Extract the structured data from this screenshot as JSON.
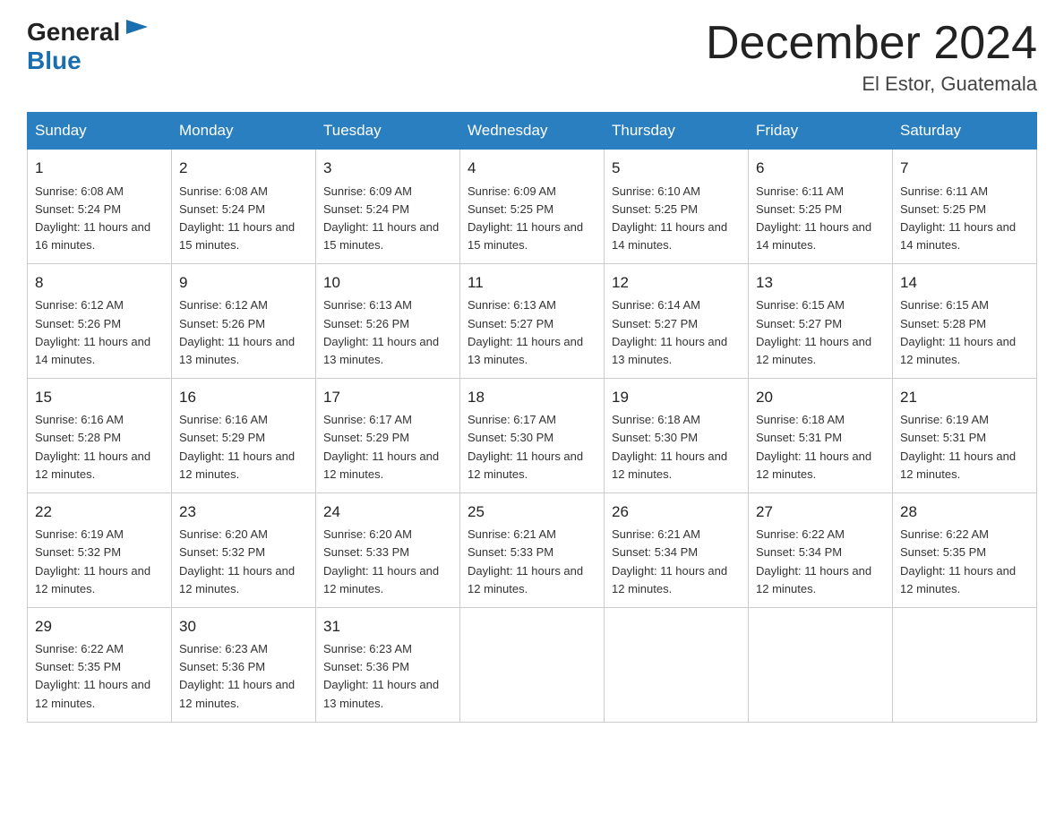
{
  "header": {
    "logo_general": "General",
    "logo_blue": "Blue",
    "month_title": "December 2024",
    "location": "El Estor, Guatemala"
  },
  "days_of_week": [
    "Sunday",
    "Monday",
    "Tuesday",
    "Wednesday",
    "Thursday",
    "Friday",
    "Saturday"
  ],
  "weeks": [
    [
      {
        "day": "1",
        "sunrise": "6:08 AM",
        "sunset": "5:24 PM",
        "daylight": "11 hours and 16 minutes."
      },
      {
        "day": "2",
        "sunrise": "6:08 AM",
        "sunset": "5:24 PM",
        "daylight": "11 hours and 15 minutes."
      },
      {
        "day": "3",
        "sunrise": "6:09 AM",
        "sunset": "5:24 PM",
        "daylight": "11 hours and 15 minutes."
      },
      {
        "day": "4",
        "sunrise": "6:09 AM",
        "sunset": "5:25 PM",
        "daylight": "11 hours and 15 minutes."
      },
      {
        "day": "5",
        "sunrise": "6:10 AM",
        "sunset": "5:25 PM",
        "daylight": "11 hours and 14 minutes."
      },
      {
        "day": "6",
        "sunrise": "6:11 AM",
        "sunset": "5:25 PM",
        "daylight": "11 hours and 14 minutes."
      },
      {
        "day": "7",
        "sunrise": "6:11 AM",
        "sunset": "5:25 PM",
        "daylight": "11 hours and 14 minutes."
      }
    ],
    [
      {
        "day": "8",
        "sunrise": "6:12 AM",
        "sunset": "5:26 PM",
        "daylight": "11 hours and 14 minutes."
      },
      {
        "day": "9",
        "sunrise": "6:12 AM",
        "sunset": "5:26 PM",
        "daylight": "11 hours and 13 minutes."
      },
      {
        "day": "10",
        "sunrise": "6:13 AM",
        "sunset": "5:26 PM",
        "daylight": "11 hours and 13 minutes."
      },
      {
        "day": "11",
        "sunrise": "6:13 AM",
        "sunset": "5:27 PM",
        "daylight": "11 hours and 13 minutes."
      },
      {
        "day": "12",
        "sunrise": "6:14 AM",
        "sunset": "5:27 PM",
        "daylight": "11 hours and 13 minutes."
      },
      {
        "day": "13",
        "sunrise": "6:15 AM",
        "sunset": "5:27 PM",
        "daylight": "11 hours and 12 minutes."
      },
      {
        "day": "14",
        "sunrise": "6:15 AM",
        "sunset": "5:28 PM",
        "daylight": "11 hours and 12 minutes."
      }
    ],
    [
      {
        "day": "15",
        "sunrise": "6:16 AM",
        "sunset": "5:28 PM",
        "daylight": "11 hours and 12 minutes."
      },
      {
        "day": "16",
        "sunrise": "6:16 AM",
        "sunset": "5:29 PM",
        "daylight": "11 hours and 12 minutes."
      },
      {
        "day": "17",
        "sunrise": "6:17 AM",
        "sunset": "5:29 PM",
        "daylight": "11 hours and 12 minutes."
      },
      {
        "day": "18",
        "sunrise": "6:17 AM",
        "sunset": "5:30 PM",
        "daylight": "11 hours and 12 minutes."
      },
      {
        "day": "19",
        "sunrise": "6:18 AM",
        "sunset": "5:30 PM",
        "daylight": "11 hours and 12 minutes."
      },
      {
        "day": "20",
        "sunrise": "6:18 AM",
        "sunset": "5:31 PM",
        "daylight": "11 hours and 12 minutes."
      },
      {
        "day": "21",
        "sunrise": "6:19 AM",
        "sunset": "5:31 PM",
        "daylight": "11 hours and 12 minutes."
      }
    ],
    [
      {
        "day": "22",
        "sunrise": "6:19 AM",
        "sunset": "5:32 PM",
        "daylight": "11 hours and 12 minutes."
      },
      {
        "day": "23",
        "sunrise": "6:20 AM",
        "sunset": "5:32 PM",
        "daylight": "11 hours and 12 minutes."
      },
      {
        "day": "24",
        "sunrise": "6:20 AM",
        "sunset": "5:33 PM",
        "daylight": "11 hours and 12 minutes."
      },
      {
        "day": "25",
        "sunrise": "6:21 AM",
        "sunset": "5:33 PM",
        "daylight": "11 hours and 12 minutes."
      },
      {
        "day": "26",
        "sunrise": "6:21 AM",
        "sunset": "5:34 PM",
        "daylight": "11 hours and 12 minutes."
      },
      {
        "day": "27",
        "sunrise": "6:22 AM",
        "sunset": "5:34 PM",
        "daylight": "11 hours and 12 minutes."
      },
      {
        "day": "28",
        "sunrise": "6:22 AM",
        "sunset": "5:35 PM",
        "daylight": "11 hours and 12 minutes."
      }
    ],
    [
      {
        "day": "29",
        "sunrise": "6:22 AM",
        "sunset": "5:35 PM",
        "daylight": "11 hours and 12 minutes."
      },
      {
        "day": "30",
        "sunrise": "6:23 AM",
        "sunset": "5:36 PM",
        "daylight": "11 hours and 12 minutes."
      },
      {
        "day": "31",
        "sunrise": "6:23 AM",
        "sunset": "5:36 PM",
        "daylight": "11 hours and 13 minutes."
      },
      null,
      null,
      null,
      null
    ]
  ]
}
